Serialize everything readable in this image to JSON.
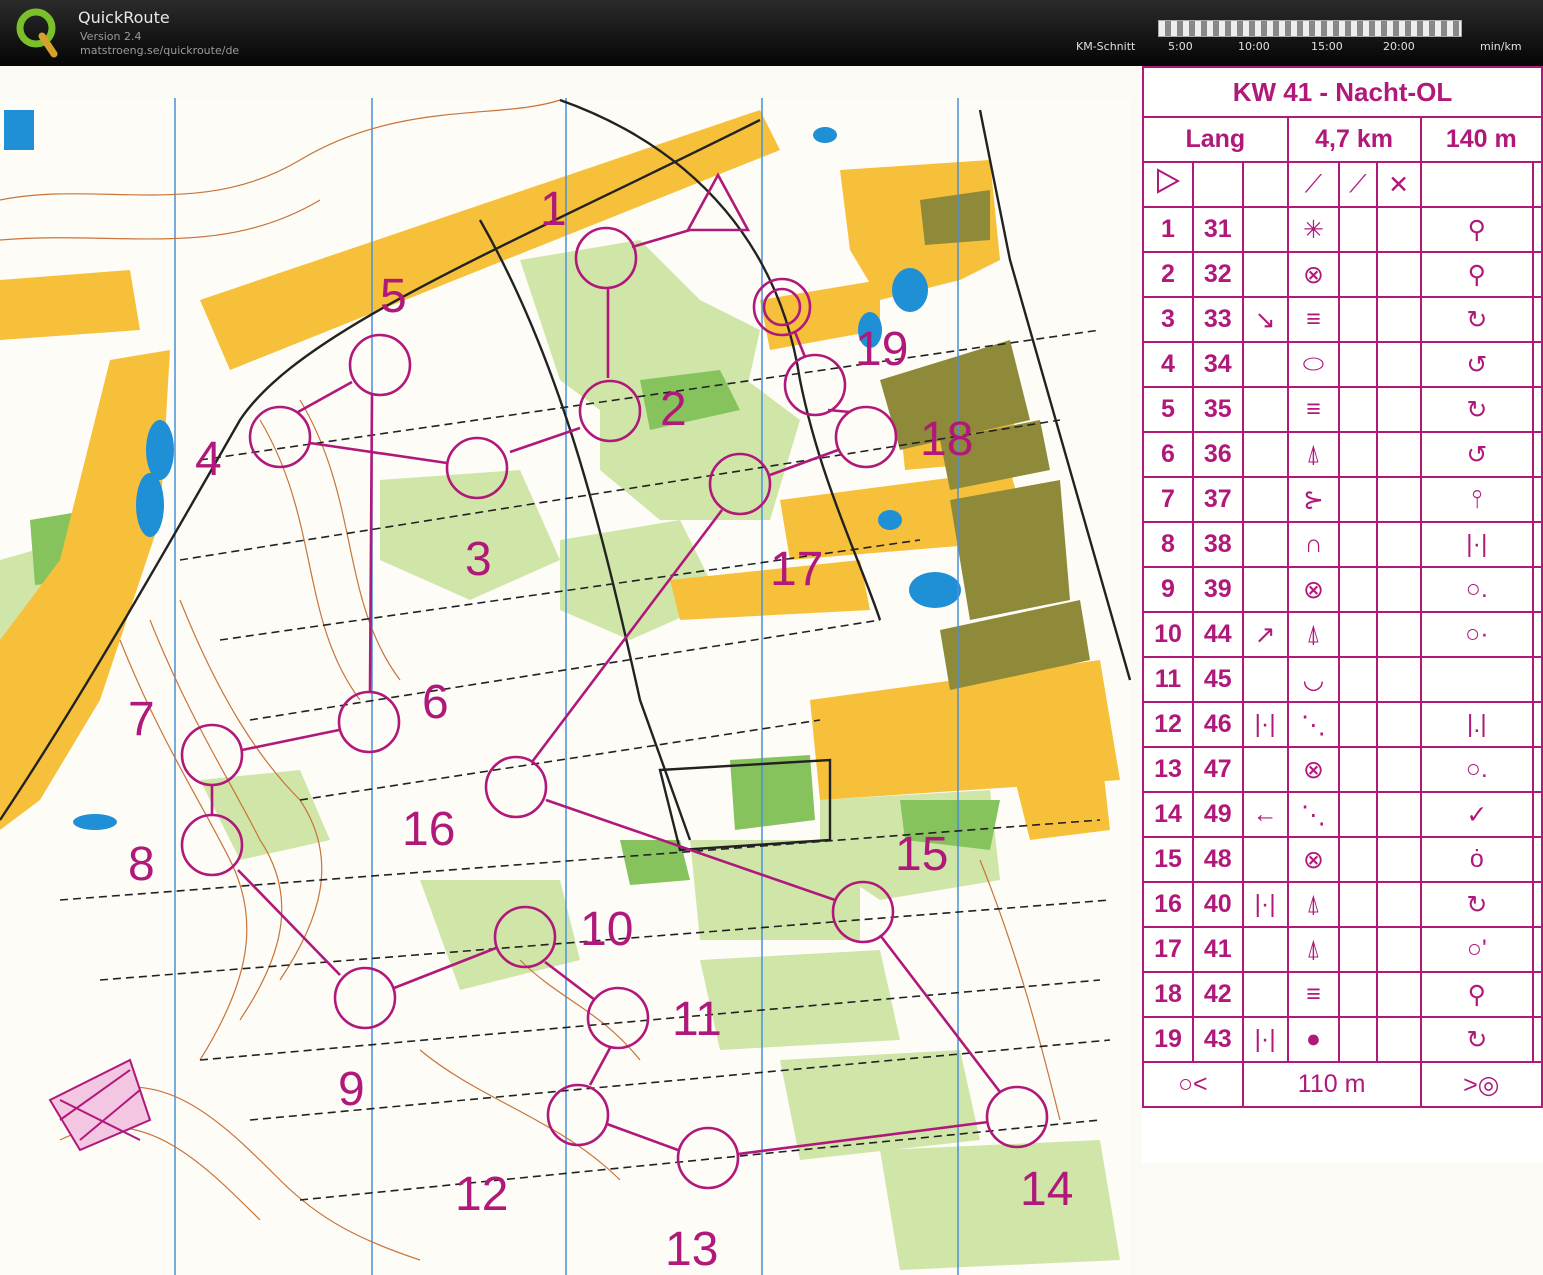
{
  "app": {
    "title": "QuickRoute",
    "version": "Version 2.4",
    "url": "matstroeng.se/quickroute/de"
  },
  "pace_scale": {
    "label": "KM-Schnitt",
    "ticks": [
      "5:00",
      "10:00",
      "15:00",
      "20:00"
    ],
    "unit": "min/km"
  },
  "legend": {
    "title": "KW 41 - Nacht-OL",
    "course": "Lang",
    "length": "4,7 km",
    "climb": "140 m",
    "finish_distance": "110 m",
    "controls": [
      {
        "num": "1",
        "code": "31",
        "dir": "",
        "feature": "✳",
        "detail": "",
        "position": "⚲"
      },
      {
        "num": "2",
        "code": "32",
        "dir": "",
        "feature": "⊗",
        "detail": "",
        "position": "⚲"
      },
      {
        "num": "3",
        "code": "33",
        "dir": "↘",
        "feature": "≡",
        "detail": "",
        "position": "↻"
      },
      {
        "num": "4",
        "code": "34",
        "dir": "",
        "feature": "⬭",
        "detail": "",
        "position": "↺"
      },
      {
        "num": "5",
        "code": "35",
        "dir": "",
        "feature": "≡",
        "detail": "",
        "position": "↻"
      },
      {
        "num": "6",
        "code": "36",
        "dir": "",
        "feature": "⍋",
        "detail": "",
        "position": "↺"
      },
      {
        "num": "7",
        "code": "37",
        "dir": "",
        "feature": "⊱",
        "detail": "",
        "position": "⫯"
      },
      {
        "num": "8",
        "code": "38",
        "dir": "",
        "feature": "∩",
        "detail": "",
        "position": "|·|"
      },
      {
        "num": "9",
        "code": "39",
        "dir": "",
        "feature": "⊗",
        "detail": "",
        "position": "○."
      },
      {
        "num": "10",
        "code": "44",
        "dir": "↗",
        "feature": "⍋",
        "detail": "",
        "position": "○·"
      },
      {
        "num": "11",
        "code": "45",
        "dir": "",
        "feature": "◡",
        "detail": "",
        "position": ""
      },
      {
        "num": "12",
        "code": "46",
        "dir": "|·|",
        "feature": "⋱",
        "detail": "",
        "position": "|.|"
      },
      {
        "num": "13",
        "code": "47",
        "dir": "",
        "feature": "⊗",
        "detail": "",
        "position": "○."
      },
      {
        "num": "14",
        "code": "49",
        "dir": "←",
        "feature": "⋱",
        "detail": "",
        "position": "✓"
      },
      {
        "num": "15",
        "code": "48",
        "dir": "",
        "feature": "⊗",
        "detail": "",
        "position": "ȯ"
      },
      {
        "num": "16",
        "code": "40",
        "dir": "|·|",
        "feature": "⍋",
        "detail": "",
        "position": "↻"
      },
      {
        "num": "17",
        "code": "41",
        "dir": "",
        "feature": "⍋",
        "detail": "",
        "position": "○'"
      },
      {
        "num": "18",
        "code": "42",
        "dir": "",
        "feature": "≡",
        "detail": "",
        "position": "⚲"
      },
      {
        "num": "19",
        "code": "43",
        "dir": "|·|",
        "feature": "●",
        "detail": "",
        "position": "↻"
      }
    ]
  },
  "map": {
    "course_color": "#b0187a",
    "labels": [
      "1",
      "2",
      "3",
      "4",
      "5",
      "6",
      "7",
      "8",
      "9",
      "10",
      "11",
      "12",
      "13",
      "14",
      "15",
      "16",
      "17",
      "18",
      "19"
    ]
  }
}
